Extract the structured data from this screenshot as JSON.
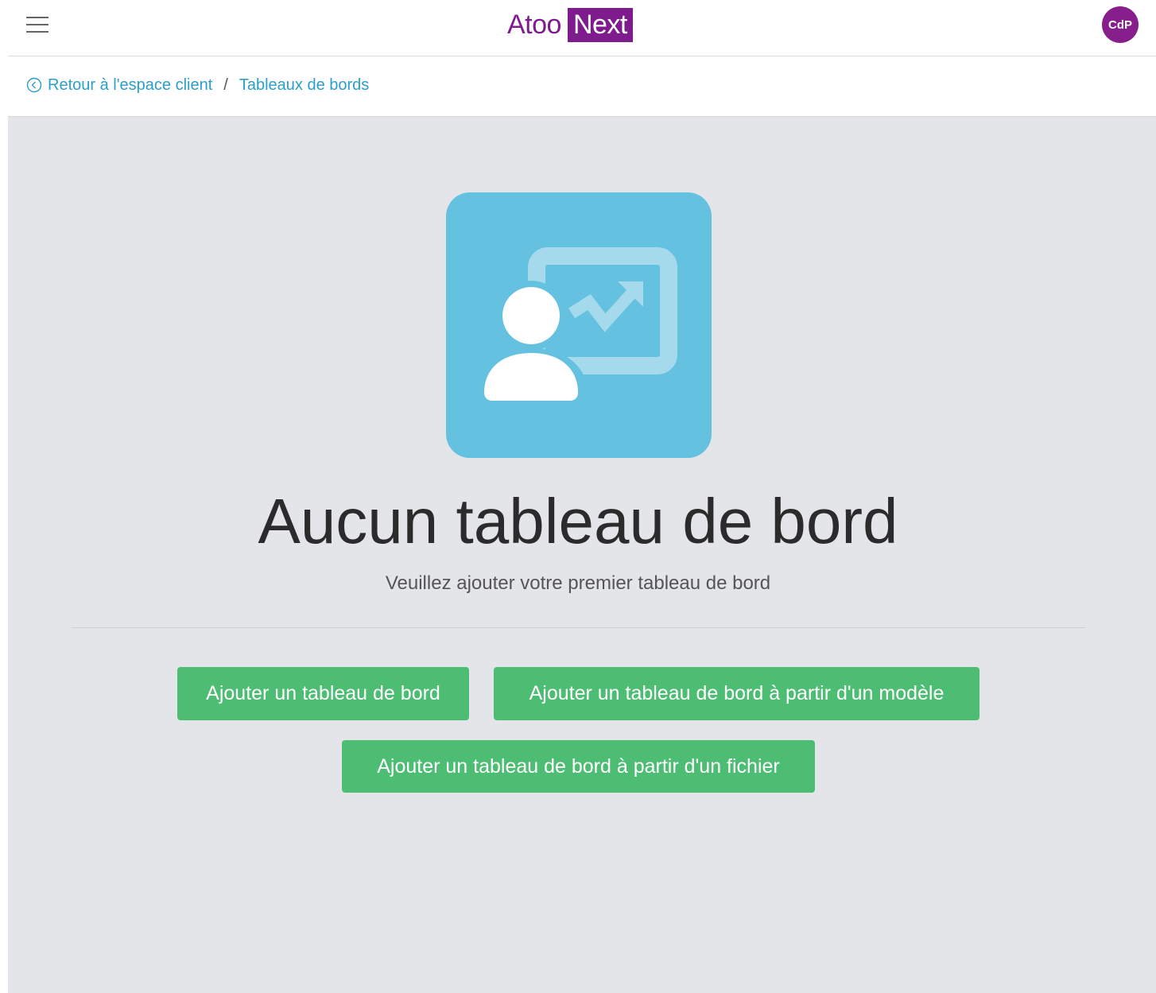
{
  "header": {
    "logo_part1": "Atoo",
    "logo_part2": "Next",
    "avatar_initials": "CdP",
    "menu_icon": "hamburger-menu-icon",
    "brand_color": "#7e1c8e"
  },
  "breadcrumb": {
    "back_icon": "chevron-left-circle-icon",
    "back_label": "Retour à l'espace client",
    "separator": "/",
    "current_label": "Tableaux de bords",
    "link_color": "#2a9fc9"
  },
  "empty_state": {
    "illustration_icon": "dashboard-presentation-icon",
    "illustration_color": "#64c1df",
    "title": "Aucun tableau de bord",
    "subtitle": "Veuillez ajouter votre premier tableau de bord"
  },
  "actions": {
    "add_dashboard": "Ajouter un tableau de bord",
    "add_from_template": "Ajouter un tableau de bord à partir d'un modèle",
    "add_from_file": "Ajouter un tableau de bord à partir d'un fichier",
    "button_color": "#4dbd74"
  }
}
